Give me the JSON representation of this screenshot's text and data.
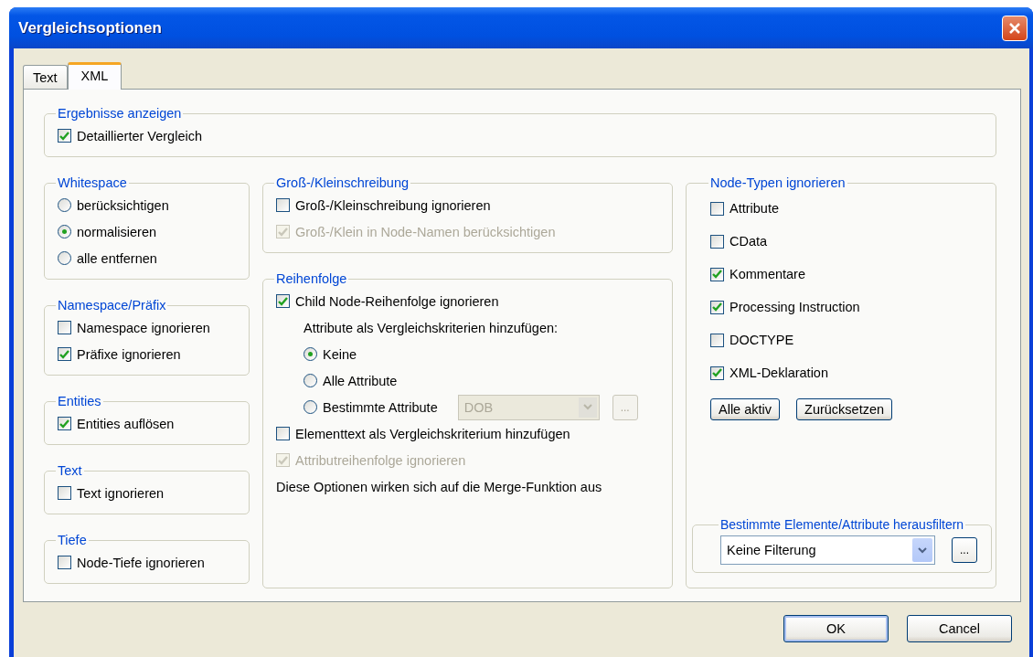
{
  "window": {
    "title": "Vergleichsoptionen"
  },
  "tabs": [
    {
      "label": "Text",
      "selected": false
    },
    {
      "label": "XML",
      "selected": true
    }
  ],
  "results_group": {
    "title": "Ergebnisse anzeigen",
    "items": [
      {
        "kind": "checkbox",
        "label": "Detaillierter Vergleich",
        "checked": true,
        "disabled": false
      }
    ]
  },
  "left_column": [
    {
      "title": "Whitespace",
      "items": [
        {
          "kind": "radio",
          "label": "berücksichtigen",
          "selected": false
        },
        {
          "kind": "radio",
          "label": "normalisieren",
          "selected": true
        },
        {
          "kind": "radio",
          "label": "alle entfernen",
          "selected": false
        }
      ]
    },
    {
      "title": "Namespace/Präfix",
      "items": [
        {
          "kind": "checkbox",
          "label": "Namespace ignorieren",
          "checked": false,
          "disabled": false
        },
        {
          "kind": "checkbox",
          "label": "Präfixe ignorieren",
          "checked": true,
          "disabled": false
        }
      ]
    },
    {
      "title": "Entities",
      "items": [
        {
          "kind": "checkbox",
          "label": "Entities auflösen",
          "checked": true,
          "disabled": false
        }
      ]
    },
    {
      "title": "Text",
      "items": [
        {
          "kind": "checkbox",
          "label": "Text ignorieren",
          "checked": false,
          "disabled": false
        }
      ]
    },
    {
      "title": "Tiefe",
      "items": [
        {
          "kind": "checkbox",
          "label": "Node-Tiefe ignorieren",
          "checked": false,
          "disabled": false
        }
      ]
    }
  ],
  "middle_column": [
    {
      "title": "Groß-/Kleinschreibung",
      "items": [
        {
          "kind": "checkbox",
          "label": "Groß-/Kleinschreibung ignorieren",
          "checked": false,
          "disabled": false
        },
        {
          "kind": "checkbox",
          "label": "Groß-/Klein in Node-Namen berücksichtigen",
          "checked": true,
          "disabled": true
        }
      ]
    },
    {
      "title": "Reihenfolge",
      "items": [
        {
          "kind": "checkbox",
          "label": "Child Node-Reihenfolge ignorieren",
          "checked": true,
          "disabled": false,
          "children": [
            {
              "kind": "text",
              "text": "Attribute als Vergleichskriterien hinzufügen:"
            },
            {
              "kind": "radio",
              "label": "Keine",
              "selected": true
            },
            {
              "kind": "radio",
              "label": "Alle Attribute",
              "selected": false
            },
            {
              "kind": "radio-combo",
              "label": "Bestimmte Attribute",
              "selected": false,
              "value": "DOB",
              "disabled": true,
              "browse": "..."
            }
          ]
        },
        {
          "kind": "checkbox",
          "label": "Elementtext als Vergleichskriterium hinzufügen",
          "checked": false,
          "disabled": false
        },
        {
          "kind": "checkbox",
          "label": "Attributreihenfolge ignorieren",
          "checked": true,
          "disabled": true
        },
        {
          "kind": "text",
          "text": "Diese Optionen wirken sich auf die Merge-Funktion aus"
        }
      ]
    }
  ],
  "node_types": {
    "title": "Node-Typen ignorieren",
    "items": [
      {
        "kind": "checkbox",
        "label": "Attribute",
        "checked": false,
        "disabled": false
      },
      {
        "kind": "checkbox",
        "label": "CData",
        "checked": false,
        "disabled": false
      },
      {
        "kind": "checkbox",
        "label": "Kommentare",
        "checked": true,
        "disabled": false
      },
      {
        "kind": "checkbox",
        "label": "Processing Instruction",
        "checked": true,
        "disabled": false
      },
      {
        "kind": "checkbox",
        "label": "DOCTYPE",
        "checked": false,
        "disabled": false
      },
      {
        "kind": "checkbox",
        "label": "XML-Deklaration",
        "checked": true,
        "disabled": false
      }
    ],
    "buttons": [
      "Alle aktiv",
      "Zurücksetzen"
    ],
    "filter": {
      "title": "Bestimmte Elemente/Attribute herausfiltern",
      "value": "Keine Filterung",
      "browse": "..."
    }
  },
  "buttons": [
    {
      "label": "OK",
      "default": true
    },
    {
      "label": "Cancel",
      "default": false
    }
  ]
}
